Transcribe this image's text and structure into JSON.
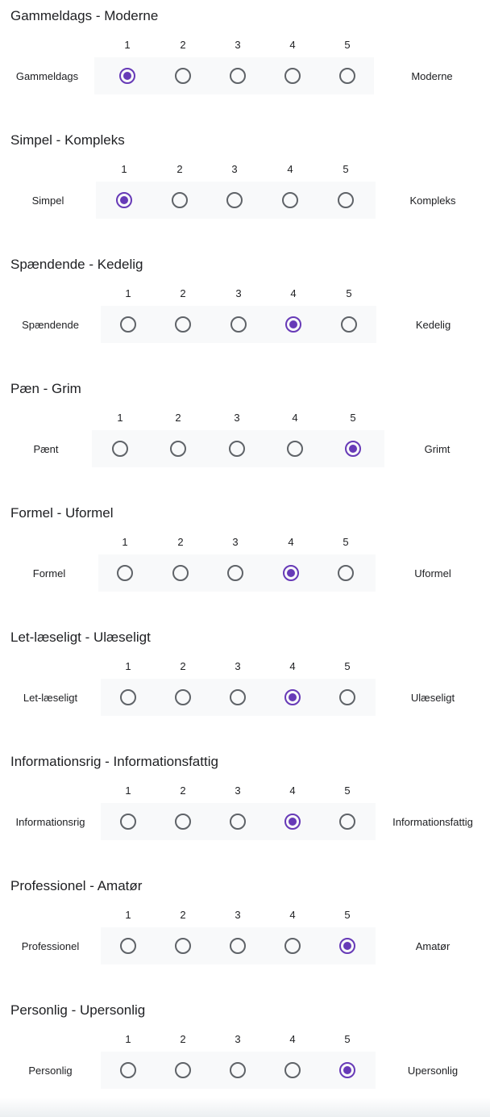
{
  "scale_numbers": [
    "1",
    "2",
    "3",
    "4",
    "5"
  ],
  "accent_color": "#673ab7",
  "questions": [
    {
      "title": "Gammeldags - Moderne",
      "left_label": "Gammeldags",
      "right_label": "Moderne",
      "selected": 1
    },
    {
      "title": "Simpel - Kompleks",
      "left_label": "Simpel",
      "right_label": "Kompleks",
      "selected": 1
    },
    {
      "title": "Spændende - Kedelig",
      "left_label": "Spændende",
      "right_label": "Kedelig",
      "selected": 4
    },
    {
      "title": "Pæn - Grim",
      "left_label": "Pænt",
      "right_label": "Grimt",
      "selected": 5
    },
    {
      "title": "Formel - Uformel",
      "left_label": "Formel",
      "right_label": "Uformel",
      "selected": 4
    },
    {
      "title": "Let-læseligt - Ulæseligt",
      "left_label": "Let-læseligt",
      "right_label": "Ulæseligt",
      "selected": 4
    },
    {
      "title": "Informationsrig - Informationsfattig",
      "left_label": "Informationsrig",
      "right_label": "Informationsfattig",
      "selected": 4
    },
    {
      "title": "Professionel - Amatør",
      "left_label": "Professionel",
      "right_label": "Amatør",
      "selected": 5
    },
    {
      "title": "Personlig - Upersonlig",
      "left_label": "Personlig",
      "right_label": "Upersonlig",
      "selected": 5
    }
  ]
}
